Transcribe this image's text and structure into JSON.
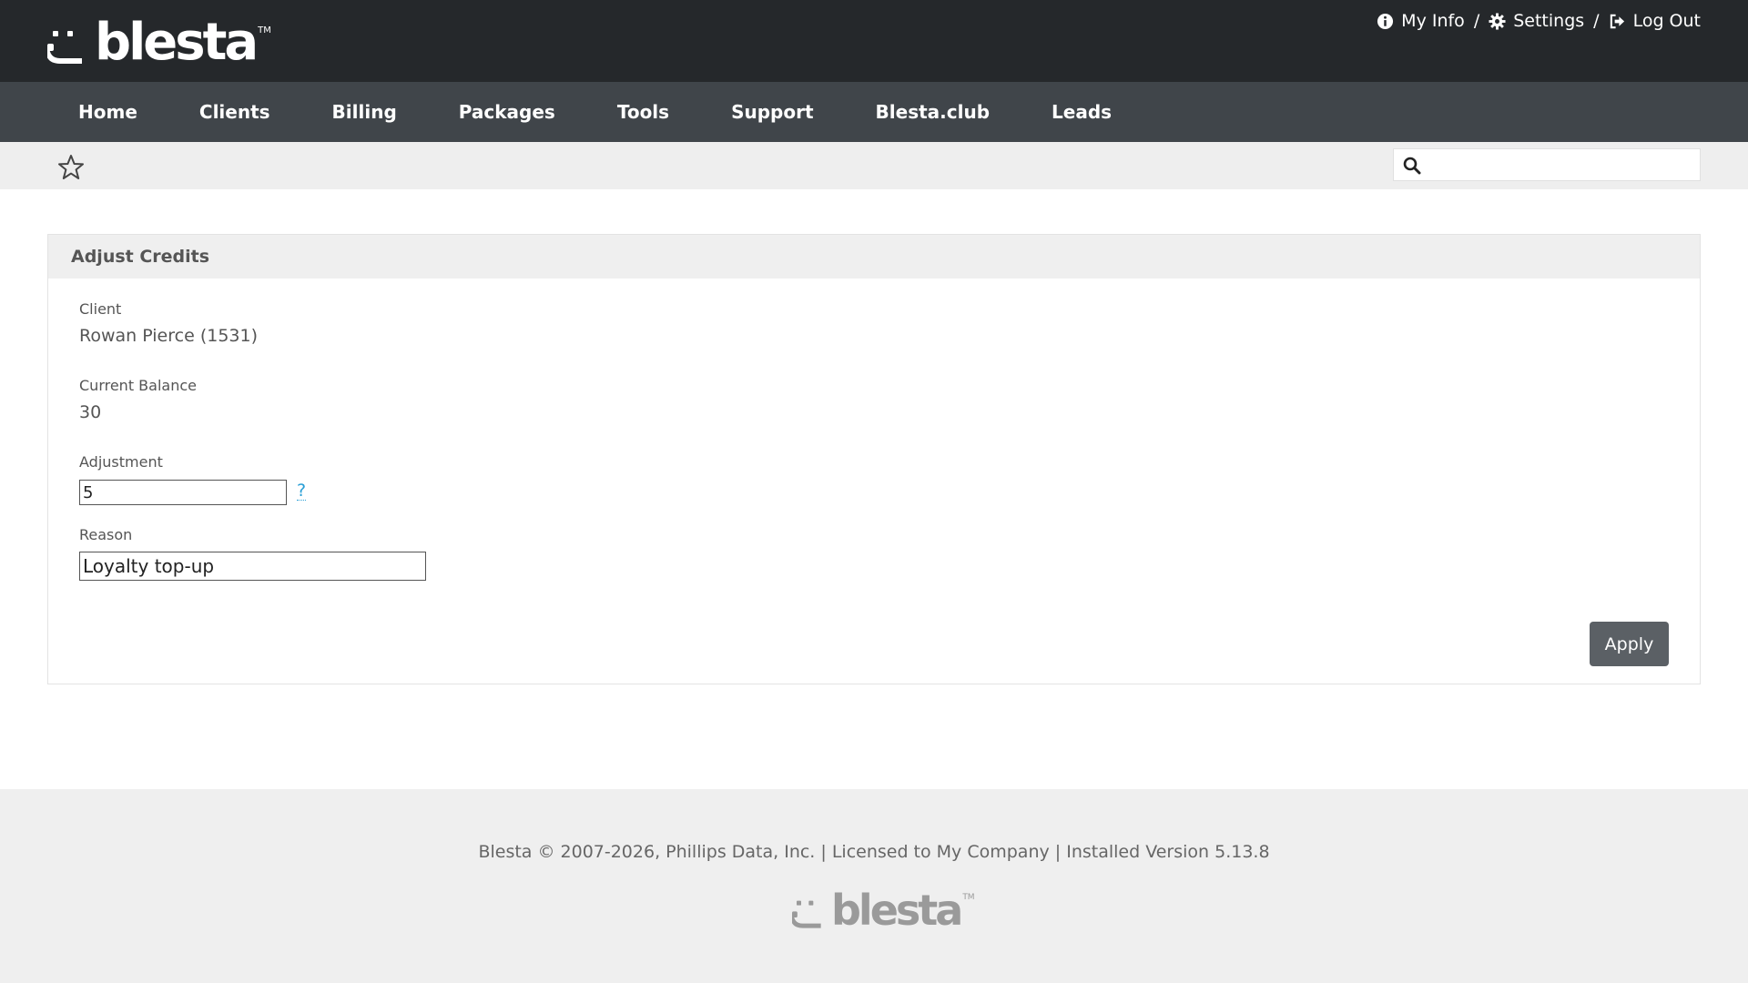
{
  "header": {
    "logo_text": "blesta",
    "logo_tm": "TM",
    "links": [
      {
        "label": "My Info",
        "icon": "info-circle-icon"
      },
      {
        "label": "Settings",
        "icon": "gear-icon"
      },
      {
        "label": "Log Out",
        "icon": "sign-out-icon"
      }
    ],
    "separator": "/"
  },
  "nav": {
    "items": [
      "Home",
      "Clients",
      "Billing",
      "Packages",
      "Tools",
      "Support",
      "Blesta.club",
      "Leads"
    ]
  },
  "subbar": {
    "search_placeholder": ""
  },
  "panel": {
    "title": "Adjust Credits",
    "client_label": "Client",
    "client_value": "Rowan Pierce (1531)",
    "balance_label": "Current Balance",
    "balance_value": "30",
    "adjustment_label": "Adjustment",
    "adjustment_value": "5",
    "help_text": "?",
    "reason_label": "Reason",
    "reason_value": "Loyalty top-up",
    "apply_label": "Apply"
  },
  "footer": {
    "text": "Blesta © 2007-2026, Phillips Data, Inc. | Licensed to My Company | Installed Version 5.13.8",
    "logo_text": "blesta",
    "logo_tm": "TM"
  },
  "colors": {
    "header_bg": "#25282b",
    "nav_bg": "#40454a",
    "subbar_bg": "#eeeeee",
    "accent_link": "#2a9fd6",
    "button_bg": "#5b6065"
  }
}
